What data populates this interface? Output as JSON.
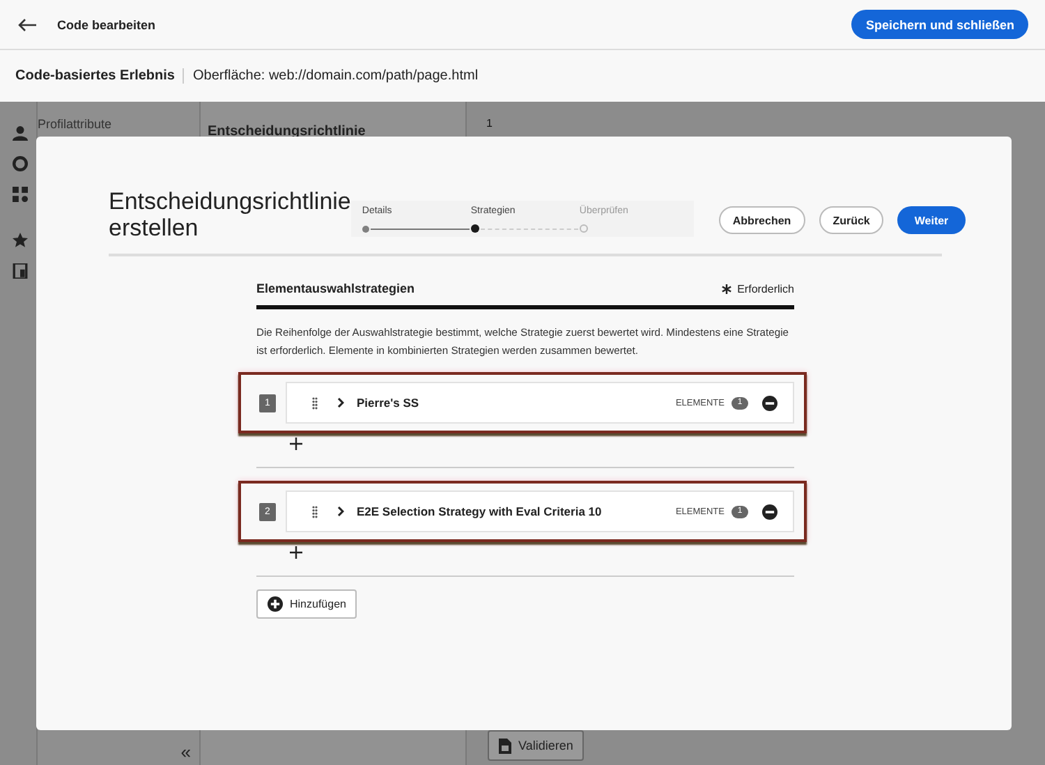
{
  "header": {
    "title": "Code bearbeiten",
    "save_button": "Speichern und schließen"
  },
  "subheader": {
    "title": "Code-basiertes Erlebnis",
    "surface": "Oberfläche: web://domain.com/path/page.html"
  },
  "background": {
    "sidebar_item": "Profilattribute",
    "panel_title": "Entscheidungsrichtlinie",
    "line_number": "1",
    "collapse": "«",
    "validate_button": "Validieren"
  },
  "dialog": {
    "title": "Entscheidungsrichtlinie erstellen",
    "steps": [
      {
        "label": "Details",
        "completed": true,
        "selected": false
      },
      {
        "label": "Strategien",
        "completed": false,
        "selected": true
      },
      {
        "label": "Überprüfen",
        "completed": false,
        "selected": false
      }
    ],
    "buttons": [
      {
        "label": "Abbrechen",
        "kind": "secondary"
      },
      {
        "label": "Zurück",
        "kind": "secondary"
      },
      {
        "label": "Weiter",
        "kind": "primary"
      }
    ],
    "section_title": "Elementauswahlstrategien",
    "required": "Erforderlich",
    "description": "Die Reihenfolge der Auswahlstrategie bestimmt, welche Strategie zuerst bewertet wird. Mindestens eine Strategie ist erforderlich. Elemente in kombinierten Strategien werden zusammen bewertet.",
    "strategies": [
      {
        "number": "1",
        "name": "Pierre's SS",
        "items_label": "ELEMENTE",
        "count": "1",
        "highlighted": true
      },
      {
        "number": "2",
        "name": "E2E Selection Strategy with Eval Criteria 10",
        "items_label": "ELEMENTE",
        "count": "1",
        "highlighted": true
      }
    ],
    "add_button": "Hinzufügen"
  }
}
